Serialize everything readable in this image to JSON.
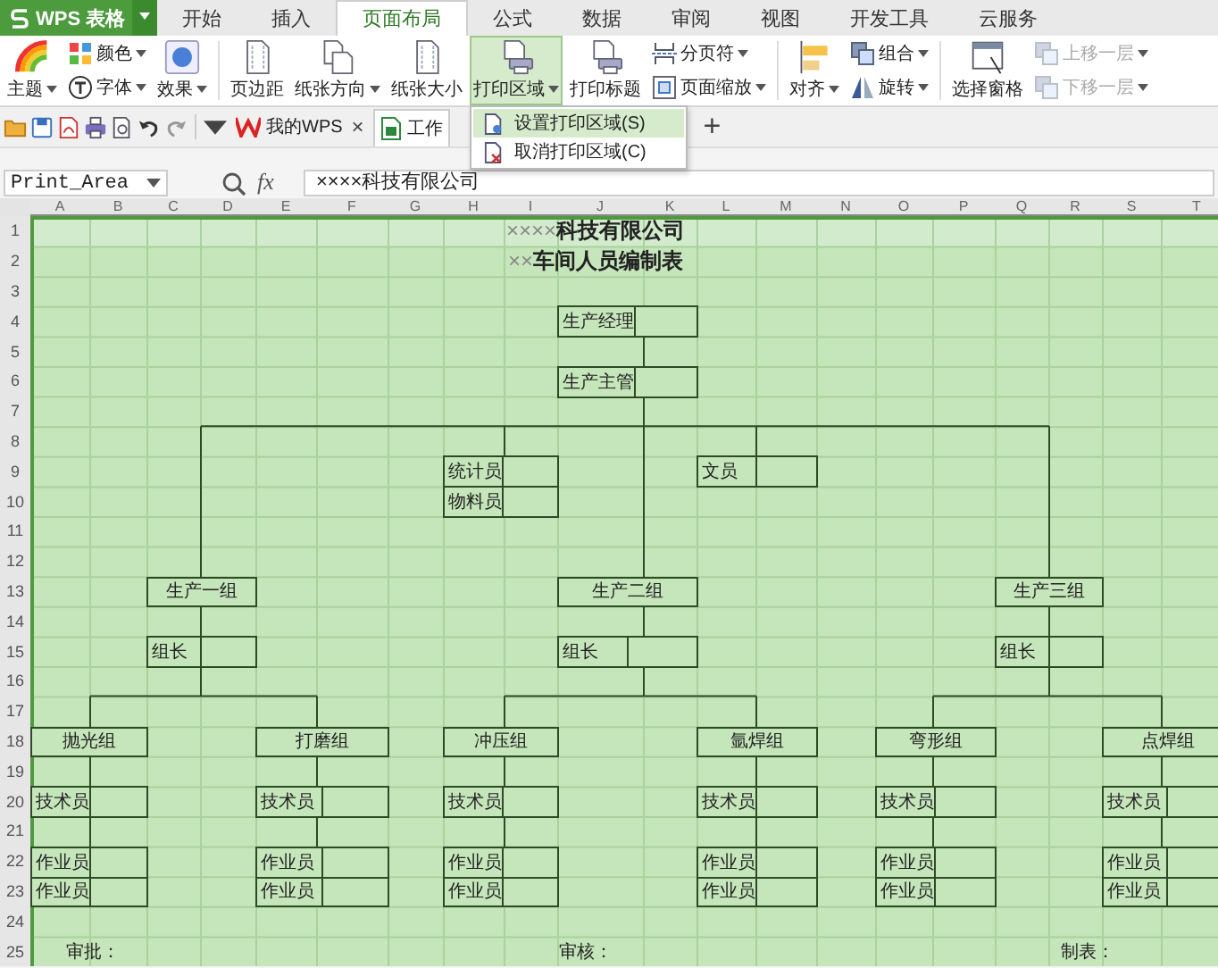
{
  "app_menu": {
    "label": "WPS 表格"
  },
  "menu_tabs": [
    {
      "label": "开始",
      "selected": false
    },
    {
      "label": "插入",
      "selected": false
    },
    {
      "label": "页面布局",
      "selected": true
    },
    {
      "label": "公式",
      "selected": false
    },
    {
      "label": "数据",
      "selected": false
    },
    {
      "label": "审阅",
      "selected": false
    },
    {
      "label": "视图",
      "selected": false
    },
    {
      "label": "开发工具",
      "selected": false
    },
    {
      "label": "云服务",
      "selected": false
    }
  ],
  "ribbon": {
    "groups": [
      {
        "columns": [
          {
            "items": [
              {
                "kind": "large",
                "label": "主题",
                "dropdown": true,
                "selected": false,
                "disabled": false
              }
            ]
          },
          {
            "items": [
              {
                "kind": "small",
                "label": "颜色",
                "dropdown": true,
                "selected": false,
                "disabled": false
              },
              {
                "kind": "small",
                "label": "字体",
                "dropdown": true,
                "selected": false,
                "disabled": false
              }
            ]
          },
          {
            "items": [
              {
                "kind": "large",
                "label": "效果",
                "dropdown": true,
                "selected": false,
                "disabled": false
              }
            ]
          }
        ]
      },
      {
        "columns": [
          {
            "items": [
              {
                "kind": "large",
                "label": "页边距",
                "dropdown": false,
                "selected": false,
                "disabled": false
              }
            ]
          },
          {
            "items": [
              {
                "kind": "large",
                "label": "纸张方向",
                "dropdown": true,
                "selected": false,
                "disabled": false
              }
            ]
          },
          {
            "items": [
              {
                "kind": "large",
                "label": "纸张大小",
                "dropdown": false,
                "selected": false,
                "disabled": false
              }
            ]
          },
          {
            "items": [
              {
                "kind": "large",
                "label": "打印区域",
                "dropdown": true,
                "selected": true,
                "disabled": false
              }
            ]
          },
          {
            "items": [
              {
                "kind": "large",
                "label": "打印标题",
                "dropdown": false,
                "selected": false,
                "disabled": false
              }
            ]
          },
          {
            "items": [
              {
                "kind": "small",
                "label": "分页符",
                "dropdown": true,
                "selected": false,
                "disabled": false
              },
              {
                "kind": "small",
                "label": "页面缩放",
                "dropdown": true,
                "selected": false,
                "disabled": false
              }
            ]
          }
        ]
      },
      {
        "columns": [
          {
            "items": [
              {
                "kind": "large",
                "label": "对齐",
                "dropdown": true,
                "selected": false,
                "disabled": false
              }
            ]
          },
          {
            "items": [
              {
                "kind": "small",
                "label": "组合",
                "dropdown": true,
                "selected": false,
                "disabled": false
              },
              {
                "kind": "small",
                "label": "旋转",
                "dropdown": true,
                "selected": false,
                "disabled": false
              }
            ]
          }
        ]
      },
      {
        "columns": [
          {
            "items": [
              {
                "kind": "large",
                "label": "选择窗格",
                "dropdown": false,
                "selected": false,
                "disabled": false
              }
            ]
          },
          {
            "items": [
              {
                "kind": "small",
                "label": "上移一层",
                "dropdown": true,
                "selected": false,
                "disabled": true
              },
              {
                "kind": "small",
                "label": "下移一层",
                "dropdown": true,
                "selected": false,
                "disabled": true
              }
            ]
          }
        ]
      }
    ]
  },
  "doc_tabs": [
    {
      "label": "我的WPS",
      "selected": false,
      "close_glyph": "×"
    },
    {
      "label": "工作",
      "selected": true
    }
  ],
  "new_tab_glyph": "+",
  "print_area_menu": [
    {
      "label": "设置打印区域(S)",
      "selected": true
    },
    {
      "label": "取消打印区域(C)",
      "selected": false
    }
  ],
  "formula_bar": {
    "name_box": "Print_Area",
    "fx": "fx",
    "formula": "××××科技有限公司"
  },
  "sheet": {
    "columns": [
      "A",
      "B",
      "C",
      "D",
      "E",
      "F",
      "G",
      "H",
      "I",
      "J",
      "K",
      "L",
      "M",
      "N",
      "O",
      "P",
      "Q",
      "R",
      "S",
      "T"
    ],
    "rows": [
      "1",
      "2",
      "3",
      "4",
      "5",
      "6",
      "7",
      "8",
      "9",
      "10",
      "11",
      "12",
      "13",
      "14",
      "15",
      "16",
      "17",
      "18",
      "19",
      "20",
      "21",
      "22",
      "23",
      "24",
      "25"
    ],
    "title": "××××**科技有限公司**",
    "subtitle": "××**车间人员编制表**",
    "top_positions": [
      "生产经理",
      "生产主管"
    ],
    "staff": [
      "统计员",
      "物料员",
      "文员"
    ],
    "departments": [
      {
        "name": "生产一组",
        "leader": "组长"
      },
      {
        "name": "生产二组",
        "leader": "组长"
      },
      {
        "name": "生产三组",
        "leader": "组长"
      }
    ],
    "groups": [
      {
        "name": "抛光组",
        "members": [
          "技术员",
          "作业员",
          "作业员"
        ]
      },
      {
        "name": "打磨组",
        "members": [
          "技术员",
          "作业员",
          "作业员"
        ]
      },
      {
        "name": "冲压组",
        "members": [
          "技术员",
          "作业员",
          "作业员"
        ]
      },
      {
        "name": "氩焊组",
        "members": [
          "技术员",
          "作业员",
          "作业员"
        ]
      },
      {
        "name": "弯形组",
        "members": [
          "技术员",
          "作业员",
          "作业员"
        ]
      },
      {
        "name": "点焊组",
        "members": [
          "技术员",
          "作业员",
          "作业员"
        ]
      }
    ],
    "signatures": [
      "审批：",
      "审核：",
      "制表："
    ]
  }
}
